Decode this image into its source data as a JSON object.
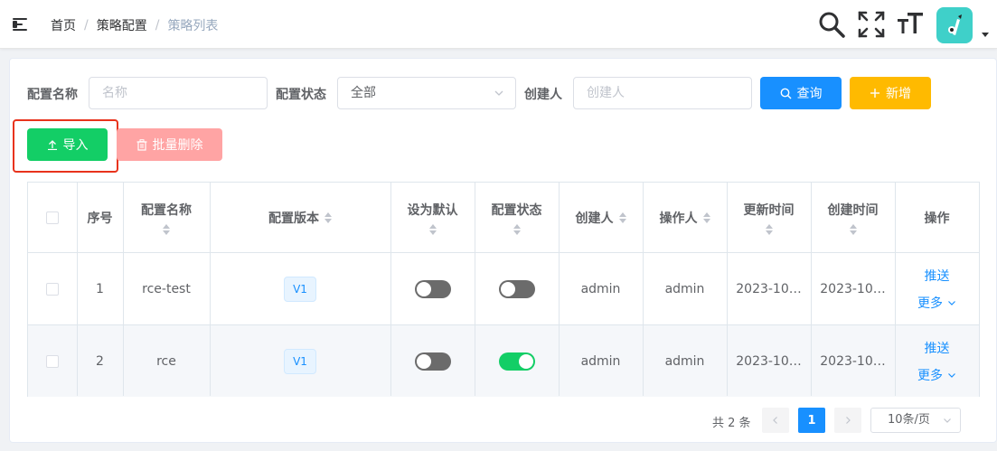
{
  "breadcrumb": [
    "首页",
    "策略配置",
    "策略列表"
  ],
  "filters": {
    "name_label": "配置名称",
    "name_placeholder": "名称",
    "status_label": "配置状态",
    "status_value": "全部",
    "creator_label": "创建人",
    "creator_placeholder": "创建人"
  },
  "buttons": {
    "search": "查询",
    "add": "新增",
    "import": "导入",
    "batch_delete": "批量删除"
  },
  "table": {
    "headers": {
      "index": "序号",
      "name": "配置名称",
      "version": "配置版本",
      "default": "设为默认",
      "status": "配置状态",
      "creator": "创建人",
      "operator": "操作人",
      "updated": "更新时间",
      "created": "创建时间",
      "actions": "操作"
    },
    "rows": [
      {
        "index": "1",
        "name": "rce-test",
        "version": "V1",
        "is_default": false,
        "status_on": false,
        "creator": "admin",
        "operator": "admin",
        "updated": "2023-10…",
        "created": "2023-10…",
        "push": "推送",
        "more": "更多"
      },
      {
        "index": "2",
        "name": "rce",
        "version": "V1",
        "is_default": false,
        "status_on": true,
        "creator": "admin",
        "operator": "admin",
        "updated": "2023-10…",
        "created": "2023-10…",
        "push": "推送",
        "more": "更多"
      }
    ]
  },
  "pagination": {
    "total_text": "共 2 条",
    "current_page": "1",
    "page_size": "10条/页"
  },
  "colors": {
    "primary": "#1890ff",
    "warning": "#ffba00",
    "success": "#13ce66",
    "danger_disabled": "#ffa4a4",
    "highlight_box": "#e8331c",
    "avatar_bg": "#3fd0c9"
  }
}
